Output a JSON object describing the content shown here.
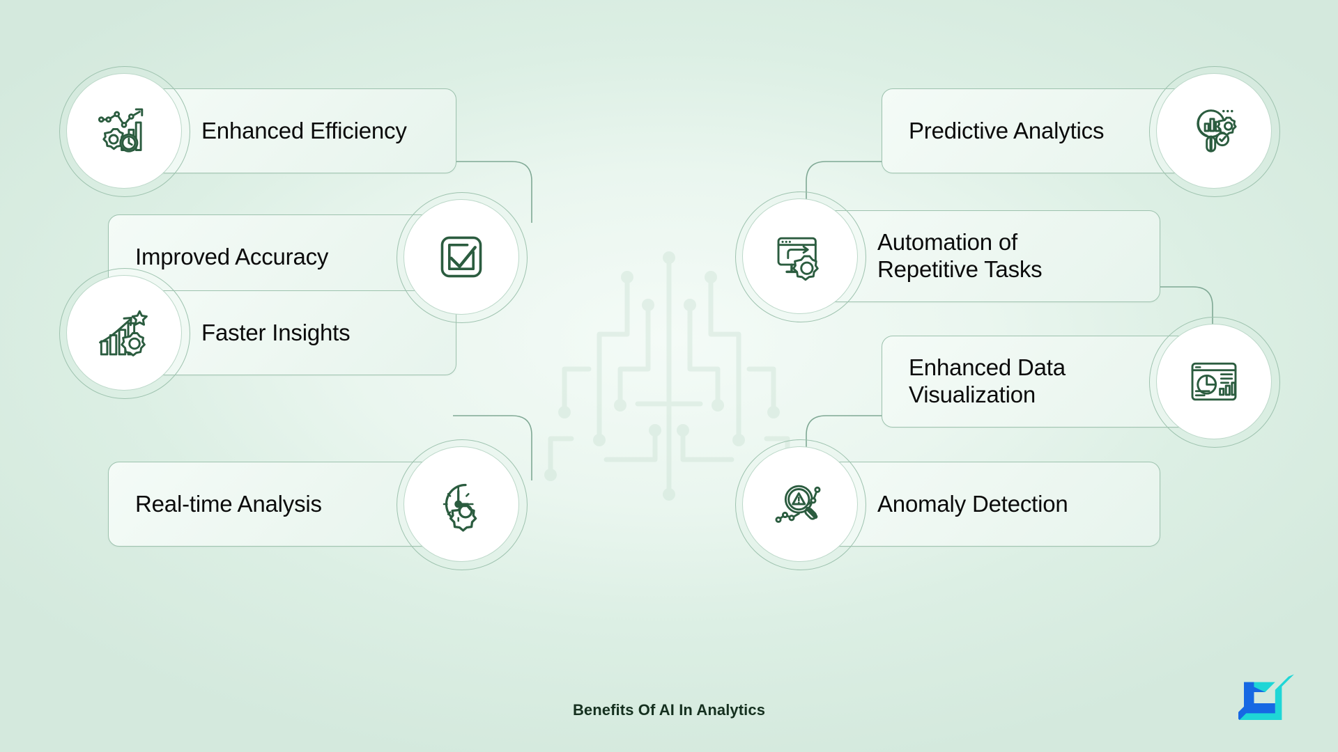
{
  "caption": "Benefits Of AI In Analytics",
  "theme": {
    "background_start": "#f4fbf7",
    "background_end": "#d4e9dd",
    "card_border": "#9dc2ae",
    "connector": "#7fa894",
    "icon_stroke": "#2b5c3f",
    "text": "#0b0b0b",
    "logo_blue": "#1668e3",
    "logo_cyan": "#1fd6d6"
  },
  "columns": {
    "left": [
      {
        "label": "Enhanced Efficiency",
        "icon": "chart-gear-clock-icon",
        "icon_side": "left"
      },
      {
        "label": "Improved Accuracy",
        "icon": "checkbox-check-icon",
        "icon_side": "right"
      },
      {
        "label": "Faster Insights",
        "icon": "growth-star-gear-icon",
        "icon_side": "left"
      },
      {
        "label": "Real-time Analysis",
        "icon": "clock-gear-icon",
        "icon_side": "right"
      }
    ],
    "right": [
      {
        "label": "Predictive Analytics",
        "icon": "magnifier-bars-gear-icon",
        "icon_side": "right"
      },
      {
        "label": "Automation of\nRepetitive Tasks",
        "icon": "monitor-arrow-gear-icon",
        "icon_side": "left"
      },
      {
        "label": "Enhanced Data\nVisualization",
        "icon": "dashboard-pie-bars-icon",
        "icon_side": "right"
      },
      {
        "label": "Anomaly Detection",
        "icon": "magnifier-warning-nodes-icon",
        "icon_side": "left"
      }
    ]
  },
  "logo": {
    "name": "brand-logo"
  }
}
